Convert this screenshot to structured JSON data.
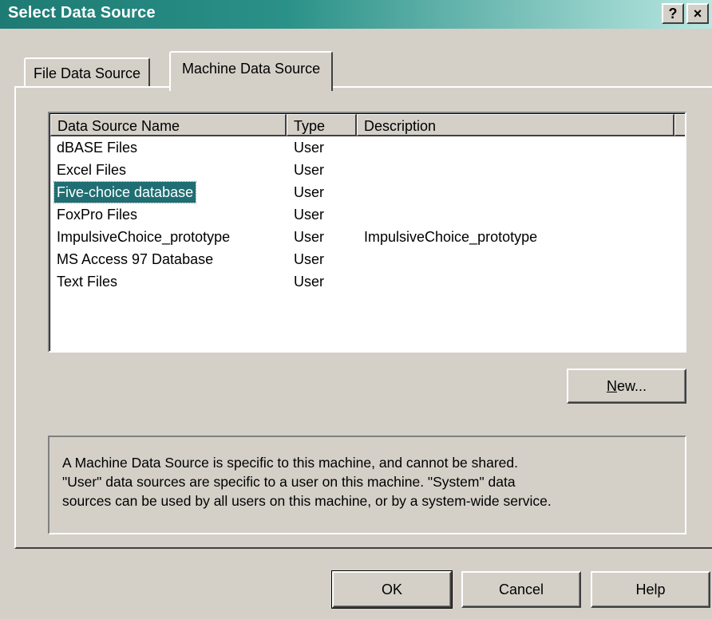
{
  "window": {
    "title": "Select Data Source",
    "help_button": "?",
    "close_button": "×"
  },
  "tabs": [
    {
      "label": "File Data Source",
      "active": false
    },
    {
      "label": "Machine Data Source",
      "active": true
    }
  ],
  "list": {
    "columns": [
      "Data Source Name",
      "Type",
      "Description"
    ],
    "rows": [
      {
        "name": "dBASE Files",
        "type": "User",
        "description": ""
      },
      {
        "name": "Excel Files",
        "type": "User",
        "description": ""
      },
      {
        "name": "Five-choice database",
        "type": "User",
        "description": "",
        "selected": true
      },
      {
        "name": "FoxPro Files",
        "type": "User",
        "description": ""
      },
      {
        "name": "ImpulsiveChoice_prototype",
        "type": "User",
        "description": "ImpulsiveChoice_prototype"
      },
      {
        "name": "MS Access 97 Database",
        "type": "User",
        "description": ""
      },
      {
        "name": "Text Files",
        "type": "User",
        "description": ""
      }
    ]
  },
  "new_button": {
    "mnemonic": "N",
    "rest": "ew..."
  },
  "description_lines": [
    "A Machine Data Source is specific to this machine, and cannot be shared.",
    "\"User\" data sources are specific to a user on this machine.  \"System\" data",
    "sources can be used by all users on this machine, or by a system-wide service."
  ],
  "footer": {
    "ok": "OK",
    "cancel": "Cancel",
    "help": "Help"
  },
  "colors": {
    "title_bar": "#1e7b74",
    "selection": "#1f6e73",
    "face": "#d4d0c8"
  }
}
